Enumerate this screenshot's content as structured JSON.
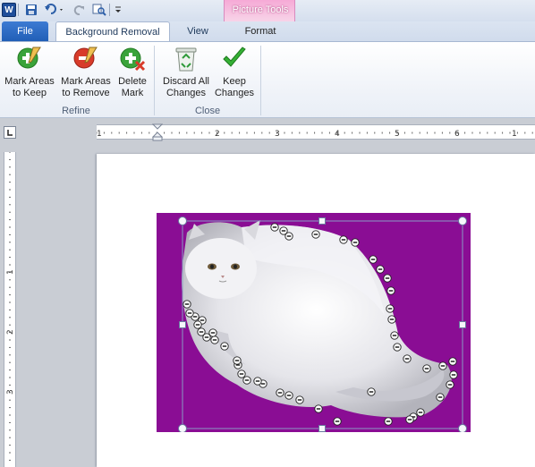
{
  "quick_access": {
    "app_letter": "W",
    "save_icon": "save-icon",
    "undo_icon": "undo-icon",
    "redo_icon": "redo-icon",
    "customize_icon": "customize-icon"
  },
  "context_group": {
    "title": "Picture Tools",
    "color": "#f6a9d6"
  },
  "tabs": {
    "file": "File",
    "background_removal": "Background Removal",
    "view": "View",
    "format": "Format"
  },
  "ribbon": {
    "refine": {
      "label": "Refine",
      "mark_keep": "Mark Areas\nto Keep",
      "mark_remove": "Mark Areas\nto Remove",
      "delete_mark": "Delete\nMark"
    },
    "close": {
      "label": "Close",
      "discard": "Discard All\nChanges",
      "keep": "Keep\nChanges"
    }
  },
  "ruler": {
    "h_numbers": [
      "1",
      "1",
      "2",
      "3",
      "4",
      "5",
      "6"
    ],
    "v_numbers": [
      "1",
      "2",
      "3"
    ]
  },
  "colors": {
    "accent": "#2b579a",
    "removal_overlay": "#8a0d94",
    "keep_green": "#3aa33a",
    "remove_red": "#d83b2a"
  }
}
